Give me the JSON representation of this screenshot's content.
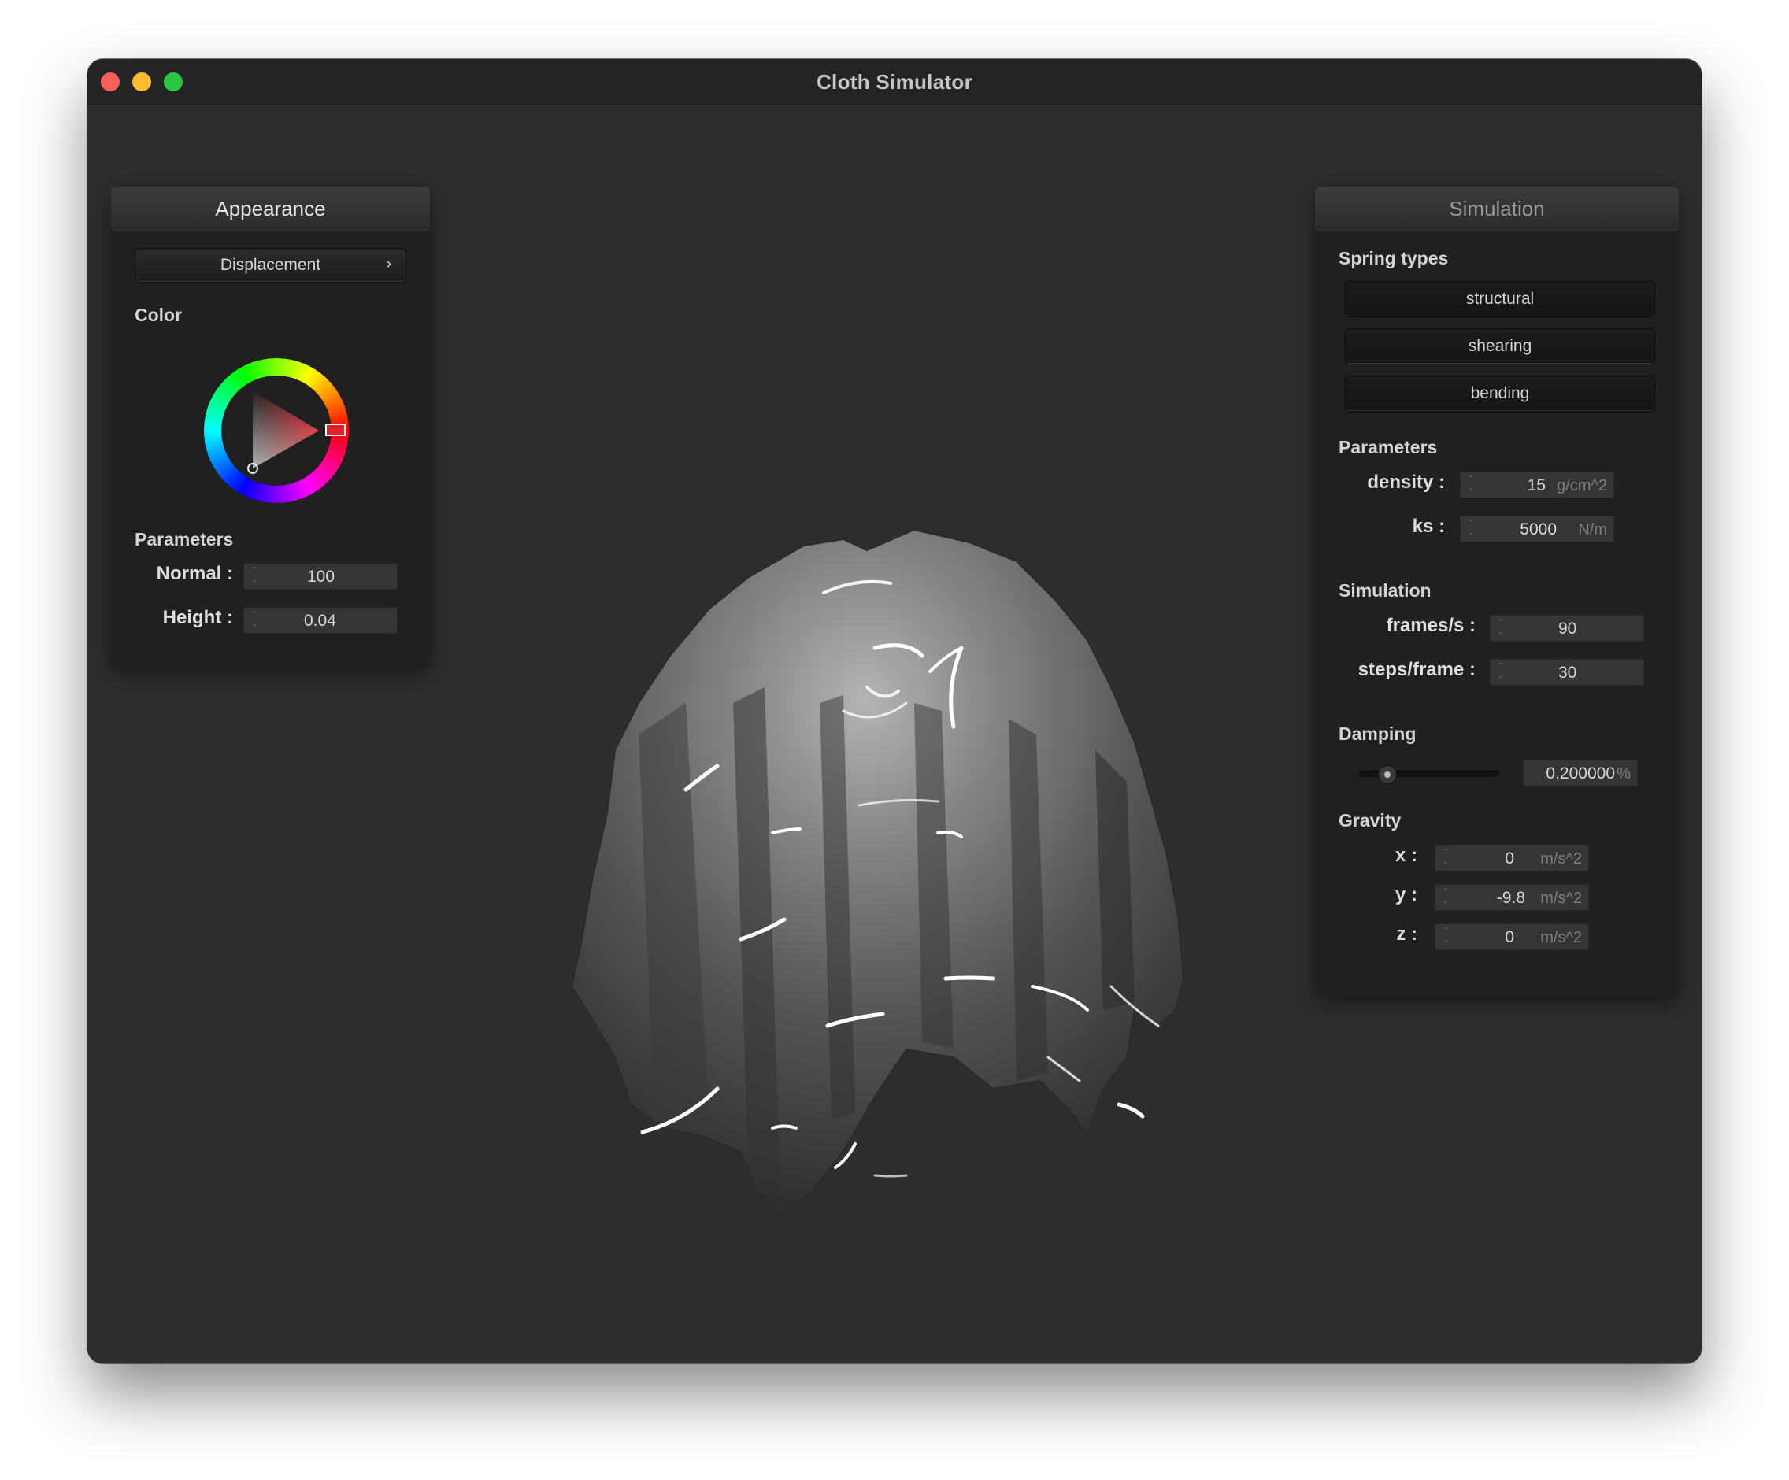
{
  "window": {
    "title": "Cloth Simulator"
  },
  "appearance": {
    "title": "Appearance",
    "shader_select": "Displacement",
    "color_label": "Color",
    "selected_color": "#e0202a",
    "parameters_label": "Parameters",
    "normal": {
      "label": "Normal :",
      "value": "100"
    },
    "height": {
      "label": "Height :",
      "value": "0.04"
    }
  },
  "simulation": {
    "title": "Simulation",
    "spring_types_label": "Spring types",
    "springs": [
      "structural",
      "shearing",
      "bending"
    ],
    "parameters_label": "Parameters",
    "density": {
      "label": "density :",
      "value": "15",
      "unit": "g/cm^2"
    },
    "ks": {
      "label": "ks :",
      "value": "5000",
      "unit": "N/m"
    },
    "sim_label": "Simulation",
    "fps": {
      "label": "frames/s :",
      "value": "90"
    },
    "steps": {
      "label": "steps/frame :",
      "value": "30"
    },
    "damping_label": "Damping",
    "damping": {
      "value": "0.200000",
      "unit": "%",
      "slider_fraction": 0.2
    },
    "gravity_label": "Gravity",
    "gx": {
      "label": "x :",
      "value": "0",
      "unit": "m/s^2"
    },
    "gy": {
      "label": "y :",
      "value": "-9.8",
      "unit": "m/s^2"
    },
    "gz": {
      "label": "z :",
      "value": "0",
      "unit": "m/s^2"
    }
  }
}
